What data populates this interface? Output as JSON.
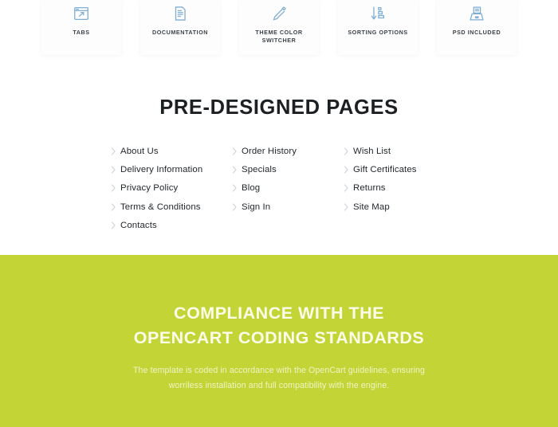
{
  "features": {
    "cards": [
      {
        "icon": "browser-window-arrow-icon",
        "label": "TABS"
      },
      {
        "icon": "document-lines-icon",
        "label": "DOCUMENTATION"
      },
      {
        "icon": "eyedropper-icon",
        "label": "THEME COLOR SWITCHER"
      },
      {
        "icon": "sort-descending-arrow-icon",
        "label": "SORTING OPTIONS"
      },
      {
        "icon": "file-tray-icon",
        "label": "PSD INCLUDED"
      }
    ]
  },
  "pages": {
    "title": "PRE-DESIGNED PAGES",
    "columns": [
      {
        "links": [
          {
            "label": "About Us"
          },
          {
            "label": "Delivery Information"
          },
          {
            "label": "Privacy Policy"
          },
          {
            "label": "Terms & Conditions"
          },
          {
            "label": "Contacts"
          }
        ]
      },
      {
        "links": [
          {
            "label": "Order History"
          },
          {
            "label": "Specials"
          },
          {
            "label": "Blog"
          },
          {
            "label": "Sign In"
          }
        ]
      },
      {
        "links": [
          {
            "label": "Wish List"
          },
          {
            "label": "Gift Certificates"
          },
          {
            "label": "Returns"
          },
          {
            "label": "Site Map"
          }
        ]
      }
    ]
  },
  "compliance": {
    "title_line1": "COMPLIANCE WITH THE",
    "title_line2": "OPENCART CODING STANDARDS",
    "text": "The template is coded in accordance with the OpenCart guidelines, ensuring worriless installation and full compatibility with the engine."
  },
  "colors": {
    "brand_green": "#c3d437",
    "icon_blue": "#7fadd4",
    "heading_dark": "#1c2023",
    "chevron_gray": "#d2d5d8"
  }
}
